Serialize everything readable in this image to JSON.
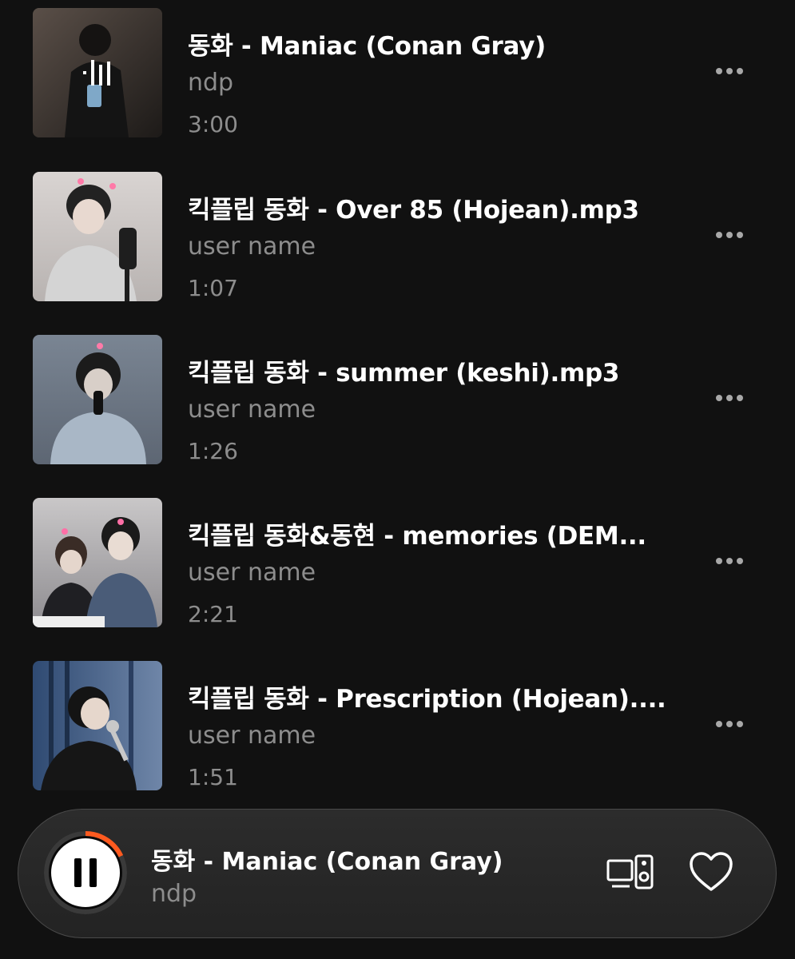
{
  "tracks": [
    {
      "title": "동화 - Maniac (Conan Gray)",
      "artist": "ndp",
      "duration": "3:00",
      "now_playing": true,
      "more_icon": "more-horizontal-icon"
    },
    {
      "title": "킥플립 동화 - Over 85 (Hojean).mp3",
      "artist": "user name",
      "duration": "1:07",
      "now_playing": false,
      "more_icon": "more-horizontal-icon"
    },
    {
      "title": "킥플립 동화 - summer (keshi).mp3",
      "artist": "user name",
      "duration": "1:26",
      "now_playing": false,
      "more_icon": "more-horizontal-icon"
    },
    {
      "title": "킥플립 동화&동현 - memories (DEM...",
      "artist": "user name",
      "duration": "2:21",
      "now_playing": false,
      "more_icon": "more-horizontal-icon"
    },
    {
      "title": "킥플립 동화 - Prescription (Hojean)....",
      "artist": "user name",
      "duration": "1:51",
      "now_playing": false,
      "more_icon": "more-horizontal-icon"
    }
  ],
  "mini_player": {
    "title": "동화 - Maniac (Conan Gray)",
    "artist": "ndp",
    "state_icon": "pause-icon",
    "progress": 0.18,
    "device_icon": "connect-device-icon",
    "like_icon": "heart-outline-icon"
  },
  "colors": {
    "background": "#111111",
    "accent": "#ff5a1f",
    "secondary_text": "#8d8d8d"
  }
}
